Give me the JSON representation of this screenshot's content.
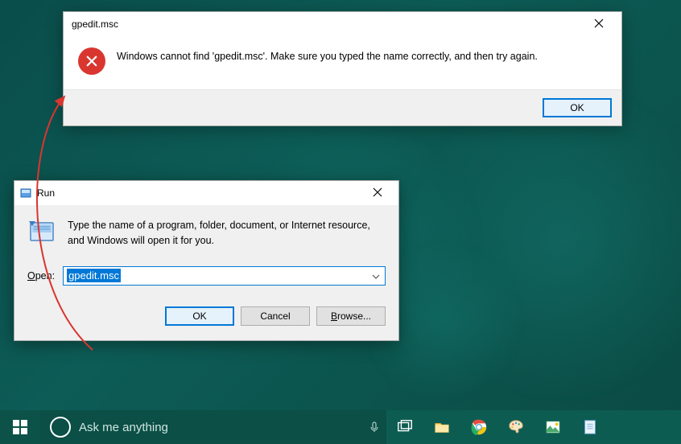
{
  "error": {
    "title": "gpedit.msc",
    "message": "Windows cannot find 'gpedit.msc'. Make sure you typed the name correctly, and then try again.",
    "ok_label": "OK"
  },
  "run": {
    "title": "Run",
    "description": "Type the name of a program, folder, document, or Internet resource, and Windows will open it for you.",
    "open_label_prefix": "O",
    "open_label_rest": "pen:",
    "value": "gpedit.msc",
    "ok_label": "OK",
    "cancel_label": "Cancel",
    "browse_prefix": "B",
    "browse_rest": "rowse..."
  },
  "taskbar": {
    "cortana_placeholder": "Ask me anything"
  }
}
